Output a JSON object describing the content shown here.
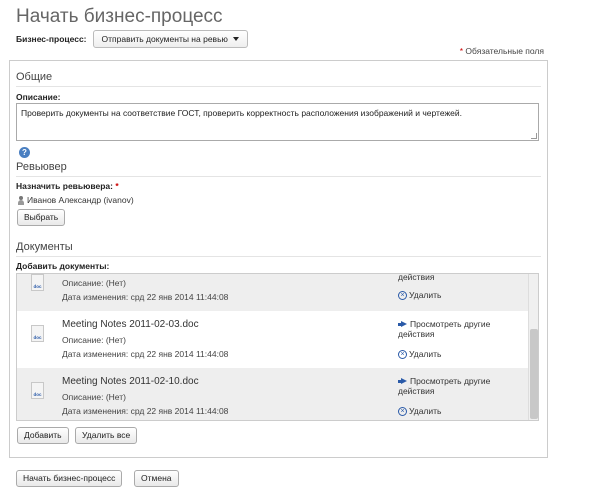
{
  "page": {
    "title": "Начать бизнес-процесс"
  },
  "business_process": {
    "label": "Бизнес-процесс:",
    "selected": "Отправить документы на ревью"
  },
  "required_note": {
    "star": "*",
    "text": "Обязательные поля"
  },
  "sections": {
    "general": {
      "title": "Общие",
      "description_label": "Описание:",
      "description_value": "Проверить документы на соответствие ГОСТ, проверить корректность расположения изображений и чертежей."
    },
    "reviewer": {
      "title": "Ревьювер",
      "assign_label": "Назначить ревьювера:",
      "star": "*",
      "assignee": "Иванов Александр (ivanov)",
      "select_button": "Выбрать"
    },
    "documents": {
      "title": "Документы",
      "add_label": "Добавить документы:",
      "items": [
        {
          "name": "",
          "description": "Описание: (Нет)",
          "modified": "Дата изменения: срд 22 янв 2014 11:44:08",
          "action_view": "действия",
          "action_delete": "Удалить",
          "icon_ext": "doc"
        },
        {
          "name": "Meeting Notes 2011-02-03.doc",
          "description": "Описание: (Нет)",
          "modified": "Дата изменения: срд 22 янв 2014 11:44:08",
          "action_view_1": "Просмотреть другие",
          "action_view_2": "действия",
          "action_delete": "Удалить",
          "icon_ext": "doc"
        },
        {
          "name": "Meeting Notes 2011-02-10.doc",
          "description": "Описание: (Нет)",
          "modified": "Дата изменения: срд 22 янв 2014 11:44:08",
          "action_view_1": "Просмотреть другие",
          "action_view_2": "действия",
          "action_delete": "Удалить",
          "icon_ext": "doc"
        }
      ],
      "add_button": "Добавить",
      "remove_all_button": "Удалить все"
    }
  },
  "footer": {
    "start_button": "Начать бизнес-процесс",
    "cancel_button": "Отмена"
  },
  "help_icon": "?",
  "colors": {
    "accent": "#2a5aa8",
    "required": "#cc0000",
    "row_alt": "#eeeeee"
  }
}
